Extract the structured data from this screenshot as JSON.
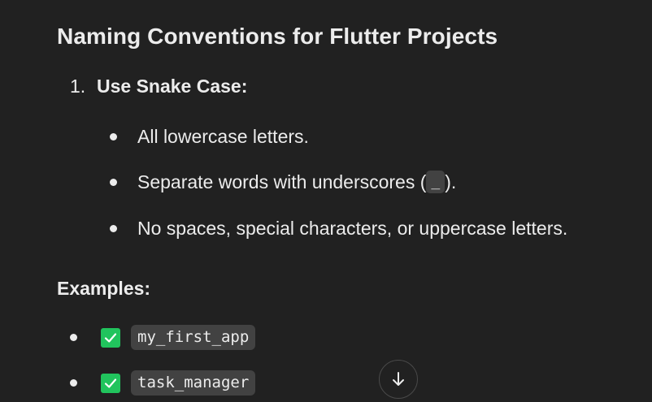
{
  "heading": "Naming Conventions for Flutter Projects",
  "ordered_list": {
    "number": "1.",
    "title": "Use Snake Case:"
  },
  "bullets": {
    "b1": "All lowercase letters.",
    "b2_before": "Separate words with underscores (",
    "b2_code": "_",
    "b2_after": ").",
    "b3": "No spaces, special characters, or uppercase letters."
  },
  "examples": {
    "label": "Examples:",
    "items": [
      "my_first_app",
      "task_manager"
    ],
    "icon": "check-mark-button-emoji"
  },
  "colors": {
    "background": "#212121",
    "text": "#ececec",
    "code_bg": "#424242",
    "check_green": "#21c45d"
  },
  "scroll_button_icon": "arrow-down-icon"
}
